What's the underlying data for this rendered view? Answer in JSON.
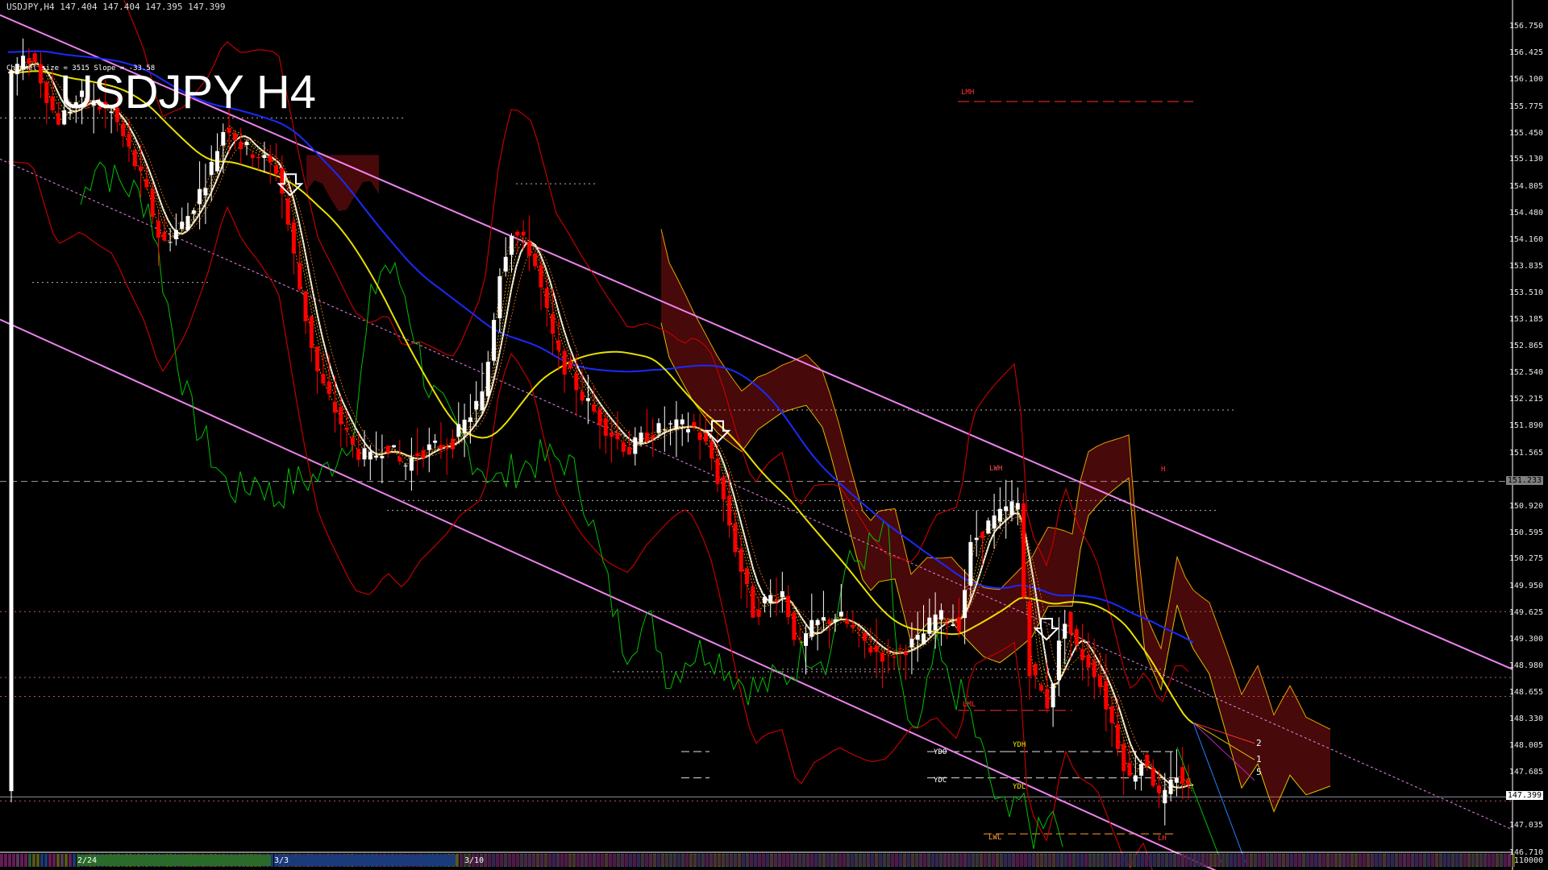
{
  "header": {
    "symbol_text": "USDJPY,H4  147.404 147.404 147.395 147.399",
    "channel_text": "Channel size = 3515 Slope = -33.58",
    "big_title": "USDJPY H4"
  },
  "price_axis": {
    "labels": [
      "156.750",
      "156.425",
      "156.100",
      "155.775",
      "155.450",
      "155.130",
      "154.805",
      "154.480",
      "154.160",
      "153.835",
      "153.510",
      "153.185",
      "152.865",
      "152.540",
      "152.215",
      "151.890",
      "151.565",
      "151.233",
      "150.920",
      "150.595",
      "150.275",
      "149.950",
      "149.625",
      "149.300",
      "148.980",
      "148.655",
      "148.330",
      "148.005",
      "147.685",
      "147.399",
      "147.035",
      "146.710"
    ],
    "current_price": "147.399",
    "line_price": "151.233",
    "bottom_value": "110000"
  },
  "time_axis": {
    "labels": [
      "2/24",
      "3/3",
      "3/10"
    ]
  },
  "levels": {
    "lmh": "LMH",
    "lml": "LML",
    "lwh": "LWH",
    "lwl": "LWL",
    "ydh": "YDH",
    "ydl": "YDL",
    "ydo": "YDO",
    "ydc": "YDC",
    "h": "H",
    "lh": "LH"
  },
  "projection_numbers": [
    "2",
    "1",
    "5"
  ],
  "colors": {
    "background": "#000000",
    "channel": "#ee82ee",
    "bull_candle": "#ffffff",
    "bear_candle": "#ff0000",
    "ma_blue": "#1a2aff",
    "ma_yellow": "#e8e000",
    "ma_white": "#ffffff",
    "chikou_green": "#00c000",
    "bollinger": "#c00000",
    "cloud": "#ff2020"
  }
}
